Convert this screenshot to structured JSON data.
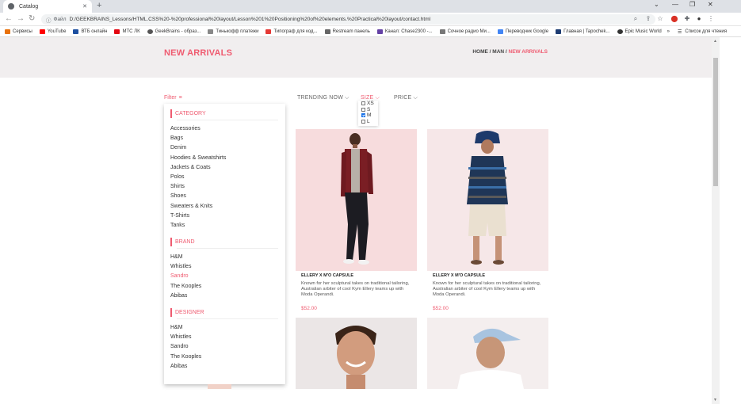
{
  "browser": {
    "tab_title": "Catalog",
    "tab_close": "✕",
    "new_tab": "+",
    "url_label": "Файл",
    "url": "D:/GEEKBRAINS_Lessons/HTML.CSS%20-%20professional%20layout/Lesson%201%20Positioning%20of%20elements.%20Practical%20layout/contact.html",
    "bookmarks": [
      "Сервисы",
      "YouTube",
      "ВТБ онлайн",
      "МТС ЛК",
      "GeekBrains - образ...",
      "Тинькофф платежи",
      "Типограф для код...",
      "Restream панель",
      "Канал: Chase2300 -...",
      "Сочное радио Ми...",
      "Переводчик Google",
      "Главная | Tapochek...",
      "Epic Music World"
    ],
    "bookmark_overflow": "»",
    "reading_list": "Список для чтения",
    "colors": {
      "accent": "#ef5b70",
      "tab_bar": "#dee1e6"
    }
  },
  "page": {
    "title": "NEW ARRIVALS",
    "breadcrumb": {
      "home": "HOME",
      "sep1": " / ",
      "man": "MAN",
      "sep2": " / ",
      "current": "NEW ARRIVALS"
    },
    "filter_label": "Filter",
    "sort": {
      "trending": "TRENDING NOW ⌵",
      "size": "SIZE ⌵",
      "price": "PRICE ⌵"
    },
    "sizes": [
      {
        "label": "XS",
        "checked": false
      },
      {
        "label": "S",
        "checked": false
      },
      {
        "label": "M",
        "checked": true
      },
      {
        "label": "L",
        "checked": false
      }
    ],
    "sidebar": {
      "category_title": "CATEGORY",
      "categories": [
        "Accessories",
        "Bags",
        "Denim",
        "Hoodies & Sweatshirts",
        "Jackets & Coats",
        "Polos",
        "Shirts",
        "Shoes",
        "Sweaters & Knits",
        "T-Shirts",
        "Tanks"
      ],
      "brand_title": "BRAND",
      "brands": [
        "H&M",
        "Whistles",
        "Sandro",
        "The Kooples",
        "Abibas"
      ],
      "designer_title": "DESIGNER",
      "designers": [
        "H&M",
        "Whistles",
        "Sandro",
        "The Kooples",
        "Abibas"
      ]
    },
    "products": [
      {
        "title": "ELLERY X M'O CAPSULE",
        "desc": "Known for her sculptural takes on traditional tailoring, Australian arbiter of cool Kym Ellery teams up with Moda Operandi.",
        "price": "$52.00"
      },
      {
        "title": "ELLERY X M'O CAPSULE",
        "desc": "Known for her sculptural takes on traditional tailoring, Australian arbiter of cool Kym Ellery teams up with Moda Operandi.",
        "price": "$52.00"
      }
    ]
  }
}
